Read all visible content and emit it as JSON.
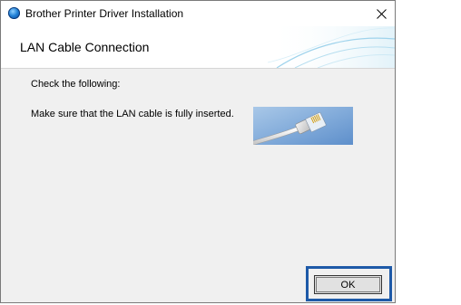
{
  "window": {
    "title": "Brother Printer Driver Installation",
    "close_symbol": "✕"
  },
  "header": {
    "title": "LAN Cable Connection"
  },
  "content": {
    "instruction": "Check the following:",
    "message": "Make sure that the LAN cable is fully inserted."
  },
  "buttons": {
    "ok_label": "OK"
  },
  "colors": {
    "highlight_border": "#1e5aa8",
    "window_background": "#f0f0f0"
  },
  "icons": {
    "app": "brother-app-icon",
    "close": "close-icon",
    "illustration": "lan-cable-illustration"
  }
}
